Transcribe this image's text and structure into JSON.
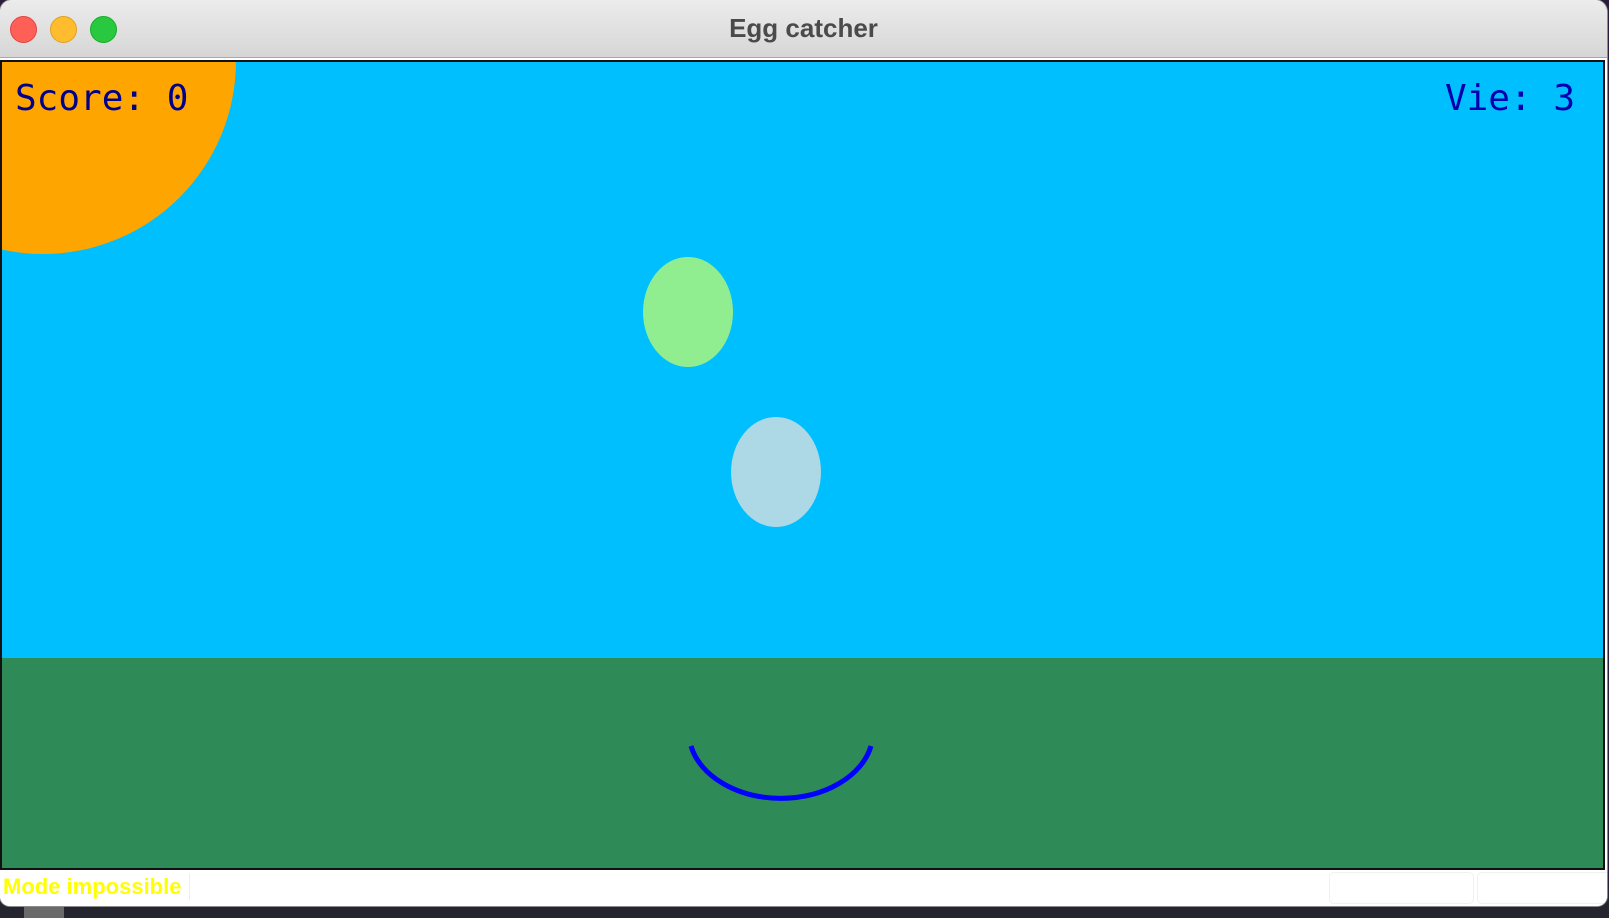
{
  "window": {
    "title": "Egg catcher"
  },
  "hud": {
    "score_text": "Score: 0",
    "lives_text": "Vie: 3"
  },
  "game": {
    "sky_color": "#00bfff",
    "grass_color": "#2e8b57",
    "sun_color": "#ffa500",
    "eggs": [
      {
        "color": "#90ee90"
      },
      {
        "color": "#add8e6"
      }
    ],
    "catcher_color": "#0000ff"
  },
  "statusbar": {
    "mode_label": "Mode impossible",
    "mode_color": "#ffff00"
  }
}
